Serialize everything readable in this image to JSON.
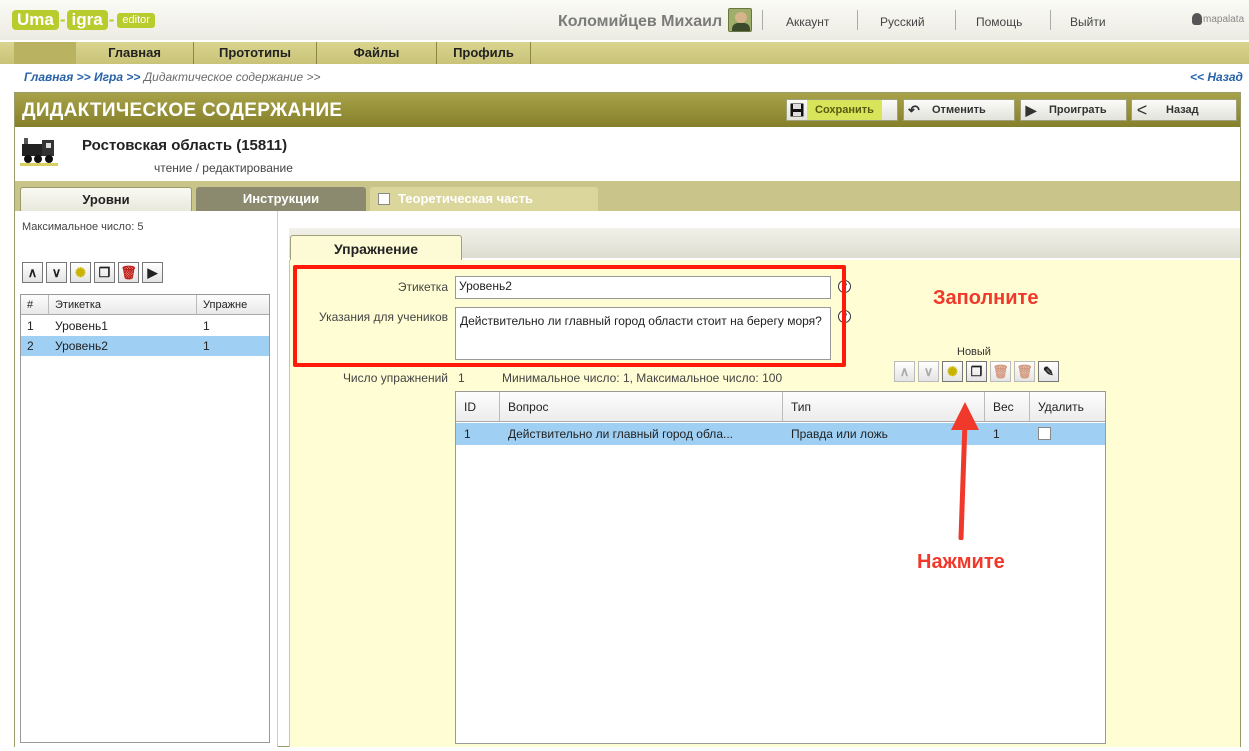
{
  "header": {
    "logo": {
      "uma": "Uma",
      "igra": "igra",
      "editor": "editor"
    },
    "user_name": "Коломийцев Михаил",
    "links": [
      "Аккаунт",
      "Русский",
      "Помощь",
      "Выйти"
    ],
    "brand": "mapalata"
  },
  "nav": {
    "items": [
      "Главная",
      "Прототипы",
      "Файлы",
      "Профиль"
    ]
  },
  "breadcrumb": {
    "home": "Главная >>",
    "game": "Игра >>",
    "current": "Дидактическое содержание >>",
    "back": "<< Назад"
  },
  "page": {
    "title": "ДИДАКТИЧЕСКОЕ СОДЕРЖАНИЕ"
  },
  "toolbar": {
    "save": "Сохранить",
    "cancel": "Отменить",
    "play": "Проиграть",
    "back": "Назад"
  },
  "game": {
    "title": "Ростовская область (15811)",
    "mode": "чтение / редактирование"
  },
  "tabs": {
    "levels": "Уровни",
    "instructions": "Инструкции",
    "theory": "Теоретическая часть"
  },
  "levels": {
    "max_label": "Максимальное число: 5",
    "columns": [
      "#",
      "Этикетка",
      "Упражне"
    ],
    "rows": [
      {
        "num": "1",
        "label": "Уровень1",
        "count": "1"
      },
      {
        "num": "2",
        "label": "Уровень2",
        "count": "1"
      }
    ],
    "selected_row": 2
  },
  "exercise": {
    "tab": "Упражнение",
    "label_field": {
      "label": "Этикетка",
      "value": "Уровень2"
    },
    "instructions_field": {
      "label": "Указания для учеников",
      "value": "Действительно ли главный город области стоит на берегу моря?"
    },
    "count_label": "Число упражнений",
    "count_value": "1",
    "limits": "Минимальное число: 1,  Максимальное число: 100",
    "new_label": "Новый",
    "columns": [
      "ID",
      "Вопрос",
      "Тип",
      "Вес",
      "Удалить"
    ],
    "rows": [
      {
        "id": "1",
        "question": "Действительно ли главный город обла...",
        "type": "Правда или ложь",
        "weight": "1",
        "delete": false
      }
    ]
  },
  "annotations": {
    "fill": "Заполните",
    "click": "Нажмите"
  },
  "colors": {
    "accent": "#d8e45a",
    "title_bar": "#8f8a34",
    "selection": "#9fd0f4",
    "annotation": "#f0392b"
  }
}
